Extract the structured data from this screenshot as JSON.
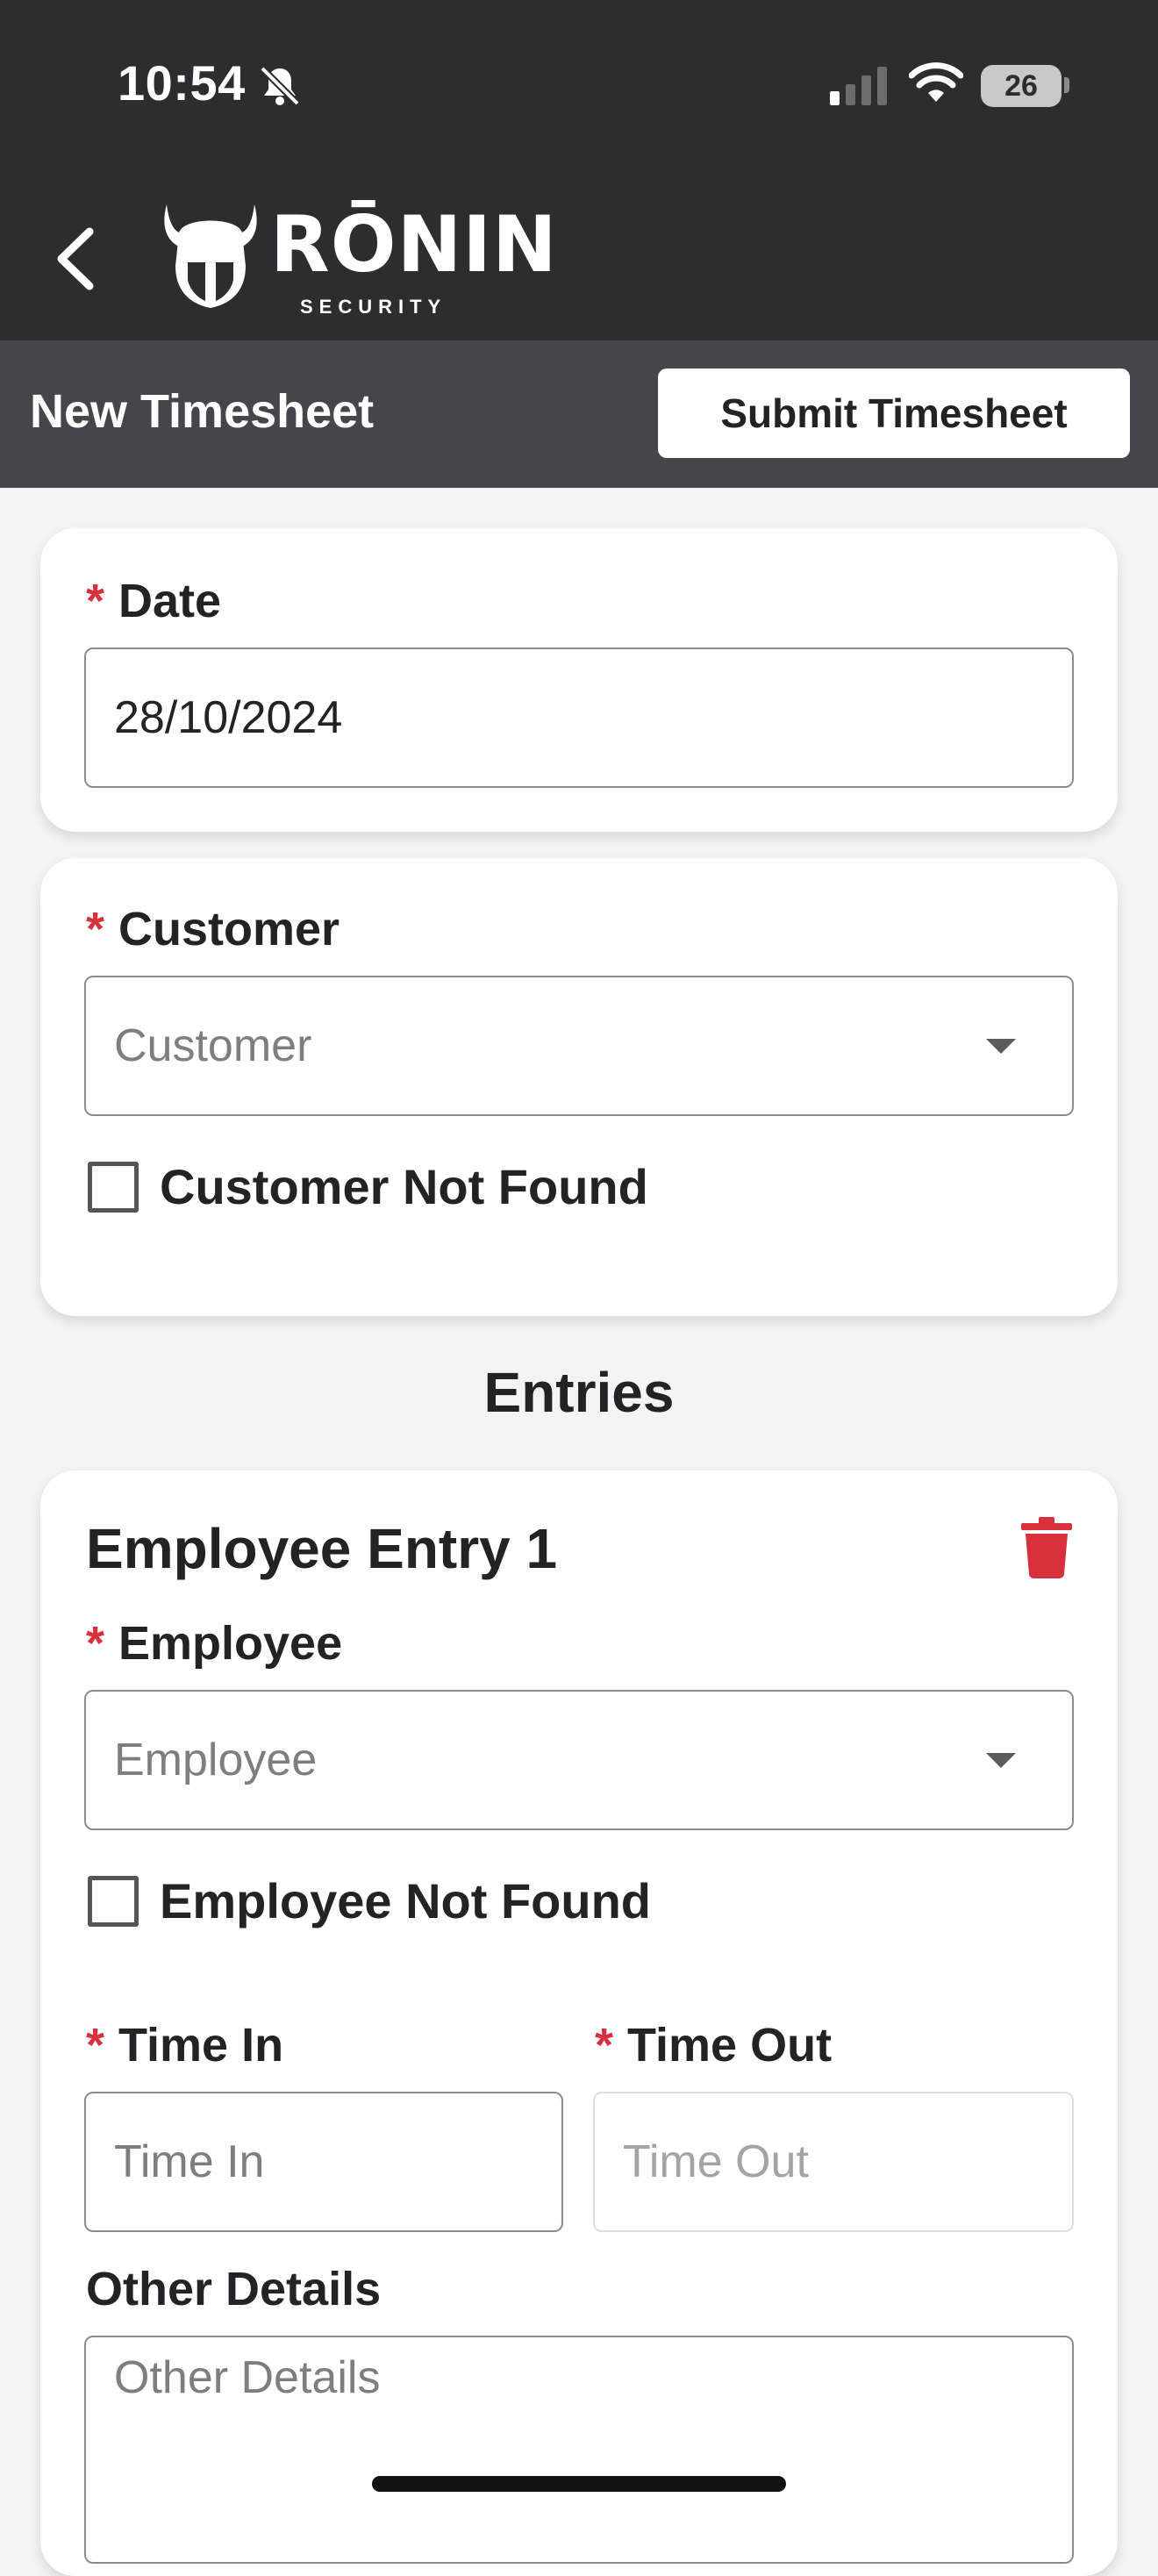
{
  "status_bar": {
    "time": "10:54",
    "battery": "26",
    "icons": [
      "bell-slash-icon",
      "cellular-signal-icon",
      "wifi-icon",
      "battery-icon"
    ]
  },
  "header": {
    "logo_text": "RŌNIN",
    "logo_subtext": "SECURITY",
    "back_icon": "chevron-left-icon"
  },
  "toolbar": {
    "title": "New Timesheet",
    "submit_label": "Submit Timesheet"
  },
  "date_card": {
    "required_mark": "*",
    "label": "Date",
    "value": "28/10/2024"
  },
  "customer_card": {
    "required_mark": "*",
    "label": "Customer",
    "placeholder": "Customer",
    "not_found_label": "Customer Not Found",
    "not_found_checked": false
  },
  "entries": {
    "heading": "Entries",
    "items": [
      {
        "title": "Employee Entry 1",
        "delete_icon": "trash-icon",
        "employee_label": "Employee",
        "employee_placeholder": "Employee",
        "employee_not_found_label": "Employee Not Found",
        "employee_not_found_checked": false,
        "time_in_label": "Time In",
        "time_in_placeholder": "Time In",
        "time_out_label": "Time Out",
        "time_out_placeholder": "Time Out",
        "other_details_label": "Other Details",
        "other_details_placeholder": "Other Details"
      }
    ]
  },
  "colors": {
    "header_bg": "#2c2d31",
    "subheader_bg": "#45464b",
    "required_red": "#d9303e",
    "page_bg": "#f4f4f5"
  }
}
